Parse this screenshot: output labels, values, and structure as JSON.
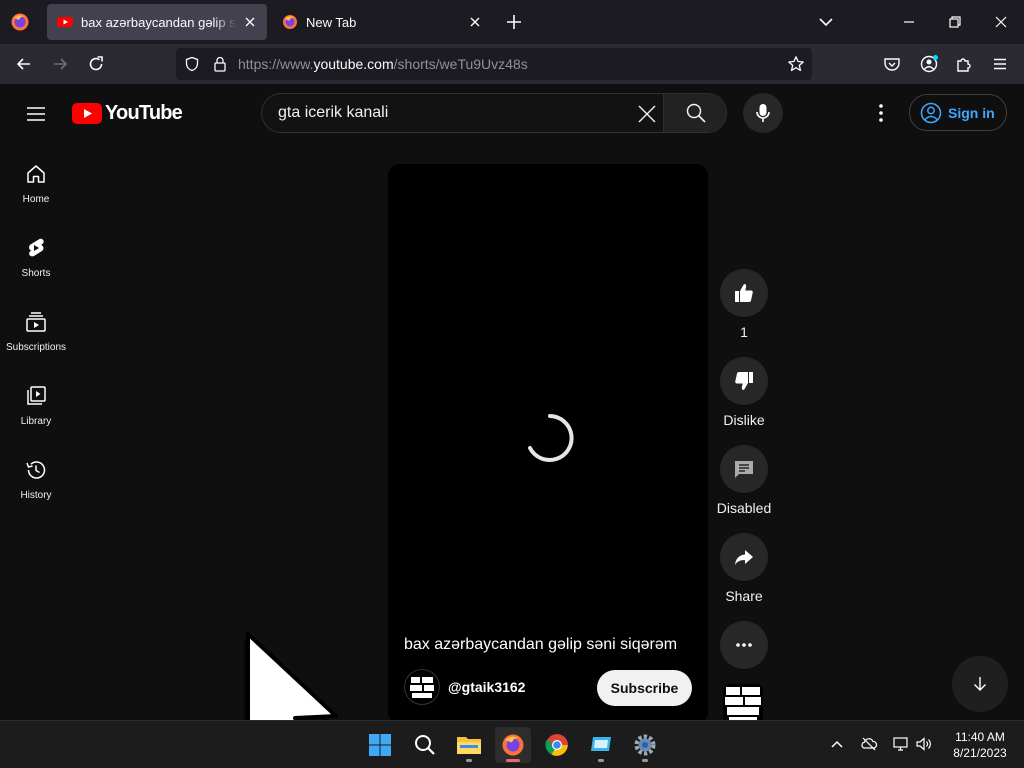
{
  "browser": {
    "tabs": [
      {
        "title": "bax azərbaycandan gəlip səni siqərəm - YouTube",
        "active": true
      },
      {
        "title": "New Tab",
        "active": false
      }
    ],
    "url": {
      "prefix": "https://www.",
      "domain": "youtube.com",
      "path": "/shorts/weTu9Uvz48s"
    }
  },
  "youtube": {
    "logo_text": "YouTube",
    "search": {
      "value": "gta icerik kanali",
      "placeholder": "Search"
    },
    "sign_in_label": "Sign in",
    "sidebar": [
      {
        "label": "Home",
        "icon": "home-icon"
      },
      {
        "label": "Shorts",
        "icon": "shorts-icon"
      },
      {
        "label": "Subscriptions",
        "icon": "subscriptions-icon"
      },
      {
        "label": "Library",
        "icon": "library-icon"
      },
      {
        "label": "History",
        "icon": "history-icon"
      }
    ],
    "short": {
      "title": "bax azərbaycandan gəlip səni siqərəm",
      "channel": "@gtaik3162",
      "subscribe_label": "Subscribe"
    },
    "actions": {
      "like_count": "1",
      "dislike_label": "Dislike",
      "comments_label": "Disabled",
      "share_label": "Share"
    }
  },
  "taskbar": {
    "time": "11:40 AM",
    "date": "8/21/2023"
  },
  "colors": {
    "youtube_red": "#ff0000",
    "link_blue": "#3ea6ff",
    "page_bg": "#0f0f0f"
  }
}
